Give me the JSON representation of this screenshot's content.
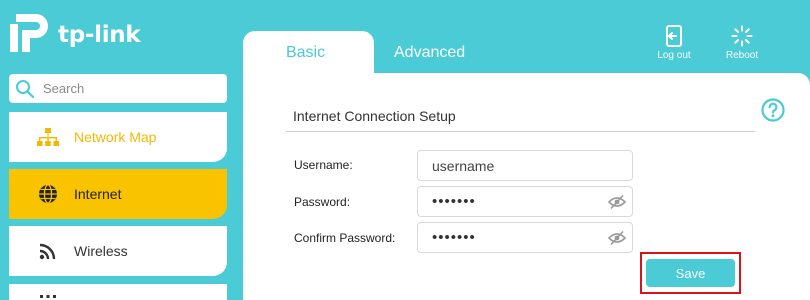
{
  "brand": {
    "name": "tp-link",
    "accent": "#4acbd6",
    "highlight": "#f9c300"
  },
  "search": {
    "placeholder": "Search",
    "icon": "search-icon"
  },
  "sidebar": {
    "items": [
      {
        "label": "Network Map",
        "icon": "network-map-icon",
        "state": "default"
      },
      {
        "label": "Internet",
        "icon": "globe-icon",
        "state": "selected"
      },
      {
        "label": "Wireless",
        "icon": "wifi-icon",
        "state": "default"
      },
      {
        "label": "",
        "icon": "more-icon",
        "state": "default"
      }
    ]
  },
  "tabs": [
    {
      "label": "Basic",
      "active": true
    },
    {
      "label": "Advanced",
      "active": false
    }
  ],
  "header_actions": {
    "logout_label": "Log out",
    "reboot_label": "Reboot"
  },
  "form": {
    "title": "Internet Connection Setup",
    "username_label": "Username:",
    "username_value": "username",
    "password_label": "Password:",
    "password_value": "•••••••",
    "confirm_label": "Confirm Password:",
    "confirm_value": "•••••••",
    "save_label": "Save"
  }
}
